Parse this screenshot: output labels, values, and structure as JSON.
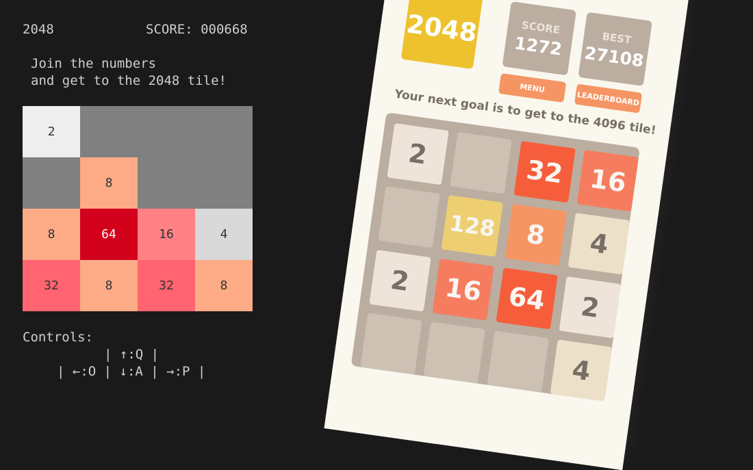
{
  "terminal": {
    "title": "2048",
    "score_line": "SCORE: 000668",
    "intro_line1": "Join the numbers",
    "intro_line2": "and get to the 2048 tile!",
    "controls_label": "Controls:",
    "controls_row1": "| ↑:Q |",
    "controls_row2": "| ←:O | ↓:A | →:P |",
    "board": [
      [
        "2",
        "",
        "",
        ""
      ],
      [
        "",
        "8",
        "",
        ""
      ],
      [
        "8",
        "64",
        "16",
        "4"
      ],
      [
        "32",
        "8",
        "32",
        "8"
      ]
    ],
    "colors": {
      "empty": "#808080",
      "2": "#eeeeee",
      "4": "#d9d9d9",
      "8": "#fcab86",
      "16": "#ff8185",
      "32": "#ff6470",
      "64": "#d2021d"
    }
  },
  "mobile": {
    "logo": "2048",
    "score_label": "SCORE",
    "score_value": "1272",
    "best_label": "BEST",
    "best_value": "27108",
    "menu_button": "MENU",
    "leaderboard_button": "LEADERBOARD",
    "goal_text": "Your next goal is to get to the 4096 tile!",
    "board": [
      [
        "2",
        "",
        "32",
        "16"
      ],
      [
        "",
        "128",
        "8",
        "4"
      ],
      [
        "2",
        "16",
        "64",
        "2"
      ],
      [
        "",
        "",
        "",
        "4"
      ]
    ],
    "colors": {
      "empty": "#cdc1b4",
      "2": "#eee4da",
      "4": "#ede0c8",
      "8": "#f59563",
      "16": "#f67c5f",
      "32": "#f65e3b",
      "64": "#f65e3b",
      "128": "#edcf72",
      "dark_text": "#776e65",
      "light_text": "#f9f6f2"
    }
  }
}
